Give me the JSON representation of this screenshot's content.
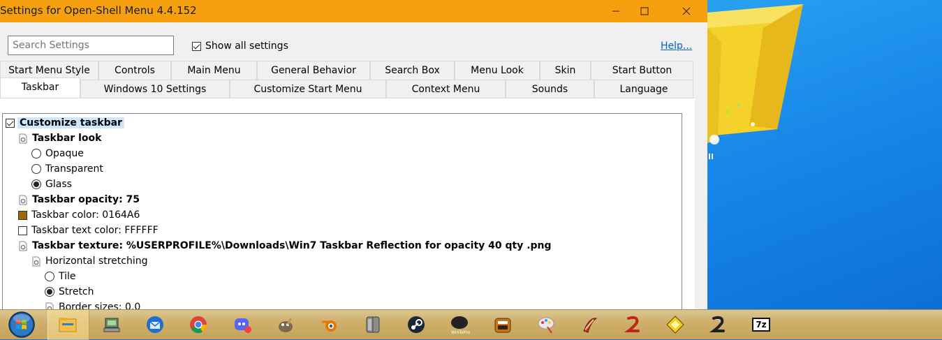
{
  "window": {
    "title": "Settings for Open-Shell Menu 4.4.152",
    "minimize_icon": "minimize-icon",
    "maximize_icon": "maximize-icon",
    "close_icon": "close-icon"
  },
  "toolbar": {
    "search_placeholder": "Search Settings",
    "show_all_label": "Show all settings",
    "show_all_checked": true,
    "help_label": "Help..."
  },
  "tabs": {
    "row1": [
      "Start Menu Style",
      "Controls",
      "Main Menu",
      "General Behavior",
      "Search Box",
      "Menu Look",
      "Skin",
      "Start Button"
    ],
    "row2": [
      "Taskbar",
      "Windows 10 Settings",
      "Customize Start Menu",
      "Context Menu",
      "Sounds",
      "Language"
    ],
    "active": "Taskbar"
  },
  "tree": {
    "customize_taskbar": "Customize taskbar",
    "taskbar_look": "Taskbar look",
    "opaque": "Opaque",
    "transparent": "Transparent",
    "glass": "Glass",
    "taskbar_opacity": "Taskbar opacity: 75",
    "taskbar_color": "Taskbar color: 0164A6",
    "taskbar_color_swatch": "#9c6a07",
    "taskbar_text_color": "Taskbar text color: FFFFFF",
    "taskbar_text_color_swatch": "#ffffff",
    "taskbar_texture": "Taskbar texture: %USERPROFILE%\\Downloads\\Win7 Taskbar Reflection for opacity 40 qty .png",
    "horizontal_stretching": "Horizontal stretching",
    "tile": "Tile",
    "stretch": "Stretch",
    "border_sizes": "Border sizes: 0,0"
  },
  "taskbar": {
    "items": [
      "start-orb-icon",
      "file-explorer-icon",
      "device-manager-icon",
      "thunderbird-icon",
      "chrome-icon",
      "discord-icon",
      "gimp-icon",
      "blender-icon",
      "wardrobe-app-icon",
      "steam-icon",
      "winaero-tweaker-icon",
      "game-app-icon",
      "paint-app-icon",
      "pen-app-icon",
      "red-app-icon",
      "yellow-diamond-app-icon",
      "dark-app-icon",
      "7zip-icon"
    ],
    "7zip_label": "7z"
  }
}
